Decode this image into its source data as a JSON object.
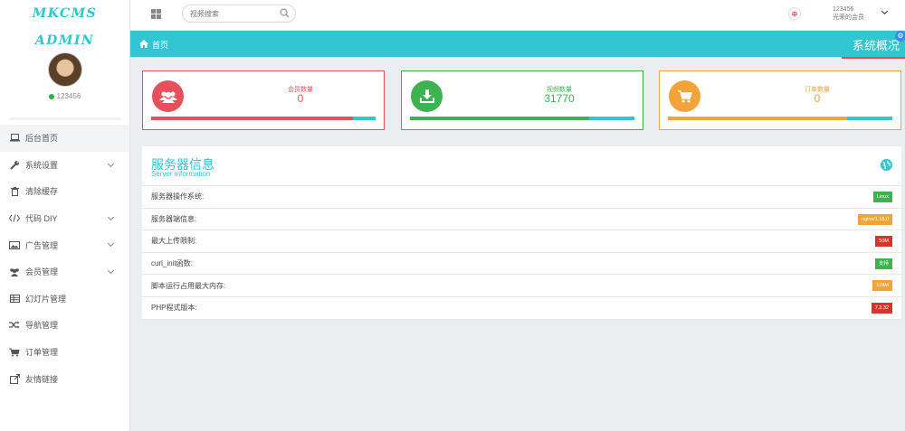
{
  "app": {
    "logo": "MKCMS ADMIN"
  },
  "profile": {
    "username": "123456"
  },
  "sidebar": {
    "items": [
      {
        "label": "后台首页",
        "icon": "laptop-icon",
        "active": true,
        "expandable": false
      },
      {
        "label": "系统设置",
        "icon": "wrench-icon",
        "active": false,
        "expandable": true
      },
      {
        "label": "清除缓存",
        "icon": "trash-icon",
        "active": false,
        "expandable": false
      },
      {
        "label": "代码 DIY",
        "icon": "code-icon",
        "active": false,
        "expandable": true
      },
      {
        "label": "广告管理",
        "icon": "image-icon",
        "active": false,
        "expandable": true
      },
      {
        "label": "会员管理",
        "icon": "users-icon",
        "active": false,
        "expandable": true
      },
      {
        "label": "幻灯片管理",
        "icon": "table-icon",
        "active": false,
        "expandable": false
      },
      {
        "label": "导航管理",
        "icon": "random-icon",
        "active": false,
        "expandable": false
      },
      {
        "label": "订单管理",
        "icon": "cart-icon",
        "active": false,
        "expandable": false
      },
      {
        "label": "友情链接",
        "icon": "external-link-icon",
        "active": false,
        "expandable": false
      }
    ]
  },
  "topbar": {
    "search_placeholder": "视频搜索",
    "user_line1": "123456",
    "user_line2": "光荣的会员"
  },
  "breadcrumb": {
    "home": "首页",
    "title": "系统概况"
  },
  "stats": [
    {
      "label": "会员数量",
      "value": "0",
      "color": "#e7505a",
      "icon": "users-icon",
      "progress": 0.9
    },
    {
      "label": "视频数量",
      "value": "31770",
      "color": "#3cb34f",
      "icon": "download-icon",
      "progress": 0.8
    },
    {
      "label": "订单数量",
      "value": "0",
      "color": "#f2a33a",
      "icon": "cart-icon",
      "progress": 0.8
    }
  ],
  "server_info": {
    "title": "服务器信息",
    "subtitle": "Server information",
    "rows": [
      {
        "label": "服务器操作系统:",
        "value": "Linux",
        "color": "#3cb34f"
      },
      {
        "label": "服务器端信息:",
        "value": "nginx/1.18.0",
        "color": "#f2a33a"
      },
      {
        "label": "最大上传限制:",
        "value": "50M",
        "color": "#d9332e"
      },
      {
        "label": "curl_init函数:",
        "value": "支持",
        "color": "#3cb34f"
      },
      {
        "label": "脚本运行占用最大内存:",
        "value": "128M",
        "color": "#f2a33a"
      },
      {
        "label": "PHP程式版本:",
        "value": "7.3.32",
        "color": "#d9332e"
      }
    ]
  }
}
